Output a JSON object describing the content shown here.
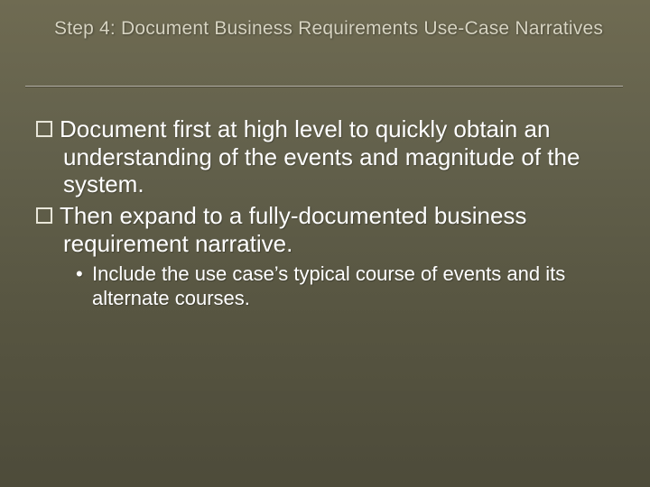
{
  "title": "Step 4: Document Business Requirements Use-Case Narratives",
  "bullets": {
    "b1": "Document first at high level to quickly obtain an understanding of the events and magnitude of the system.",
    "b2": "Then expand to a fully-documented business requirement narrative.",
    "sub1": "Include the use case’s typical course of events and its alternate courses."
  },
  "glyphs": {
    "dot": "•"
  }
}
